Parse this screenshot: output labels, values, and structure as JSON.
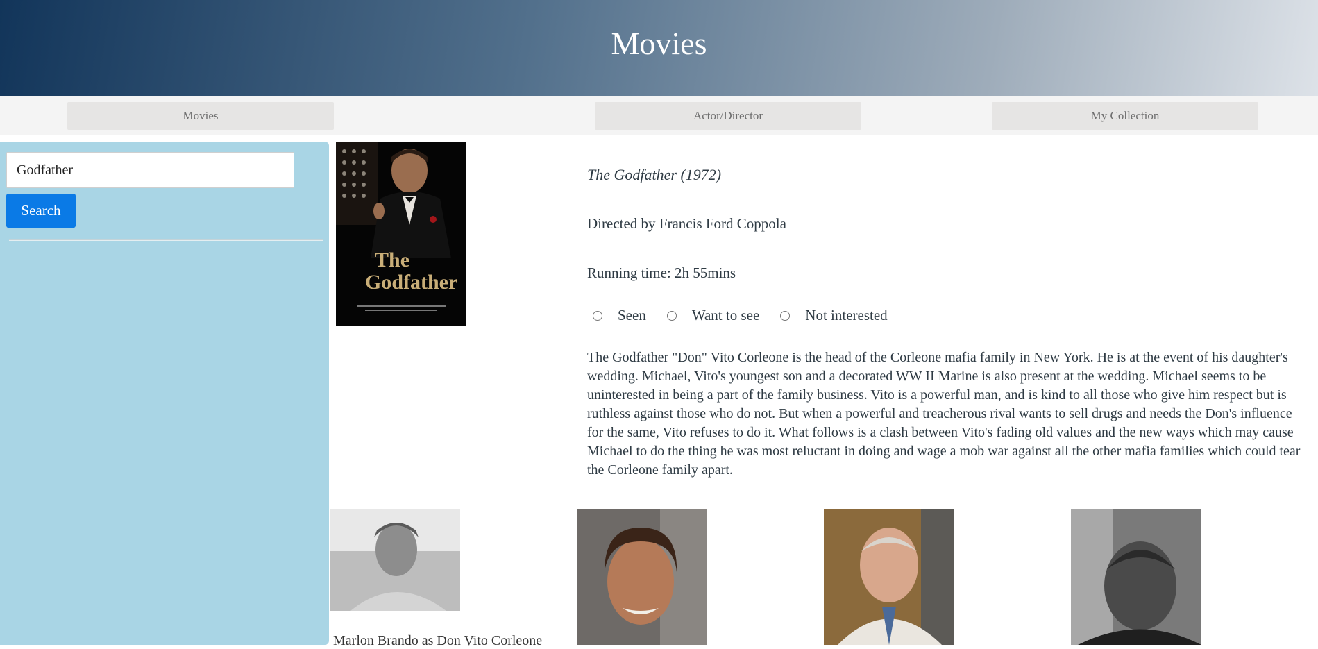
{
  "header": {
    "title": "Movies"
  },
  "nav": {
    "movies_label": "Movies",
    "actor_director_label": "Actor/Director",
    "my_collection_label": "My Collection"
  },
  "search": {
    "value": "Godfather",
    "button_label": "Search"
  },
  "movie": {
    "title": "The Godfather (1972)",
    "director": "Directed by Francis Ford Coppola",
    "runtime": "Running time: 2h 55mins",
    "status_options": [
      "Seen",
      "Want to see",
      "Not interested"
    ],
    "plot": "The Godfather \"Don\" Vito Corleone is the head of the Corleone mafia family in New York. He is at the event of his daughter's wedding. Michael, Vito's youngest son and a decorated WW II Marine is also present at the wedding. Michael seems to be uninterested in being a part of the family business. Vito is a powerful man, and is kind to all those who give him respect but is ruthless against those who do not. But when a powerful and treacherous rival wants to sell drugs and needs the Don's influence for the same, Vito refuses to do it. What follows is a clash between Vito's fading old values and the new ways which may cause Michael to do the thing he was most reluctant in doing and wage a mob war against all the other mafia families which could tear the Corleone family apart."
  },
  "cast": {
    "first_name_partial": "Marlon Brando as Don Vito Corleone"
  },
  "colors": {
    "sidebar": "#a9d5e5",
    "search_button": "#0a7ae6",
    "header_start": "#12355a",
    "header_end": "#dde2e8"
  }
}
